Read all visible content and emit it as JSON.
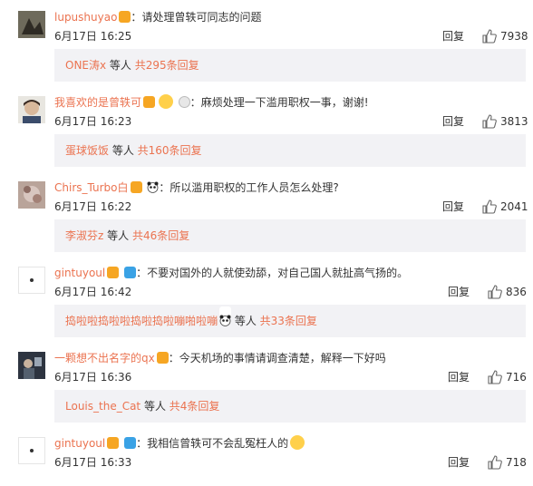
{
  "comments": [
    {
      "username": "lupushuyao",
      "text": "请处理曾轶可同志的问题",
      "time": "6月17日 16:25",
      "reply_label": "回复",
      "likes": "7938",
      "reply_summary": {
        "names": "ONE涛x",
        "middle": " 等人 ",
        "count": "共295条回复"
      }
    },
    {
      "username": "我喜欢的是曾轶可",
      "text": "麻烦处理一下滥用职权一事，谢谢!",
      "time": "6月17日 16:23",
      "reply_label": "回复",
      "likes": "3813",
      "reply_summary": {
        "names": "蛋球饭饭",
        "middle": " 等人 ",
        "count": "共160条回复"
      }
    },
    {
      "username": "Chirs_Turbo白",
      "text": "所以滥用职权的工作人员怎么处理?",
      "time": "6月17日 16:22",
      "reply_label": "回复",
      "likes": "2041",
      "reply_summary": {
        "names": "李淑芬z",
        "middle": " 等人 ",
        "count": "共46条回复"
      }
    },
    {
      "username": "gintuyoul",
      "text": "不要对国外的人就使劲舔，对自己国人就扯高气扬的。",
      "time": "6月17日 16:42",
      "reply_label": "回复",
      "likes": "836",
      "reply_summary": {
        "names": "捣啦啦捣啦啦捣啦捣啦嘣啪啦嘣",
        "middle": " 等人 ",
        "count": "共33条回复"
      }
    },
    {
      "username": "一颗想不出名字的qx",
      "text": "今天机场的事情请调查清楚，解释一下好吗",
      "time": "6月17日 16:36",
      "reply_label": "回复",
      "likes": "716",
      "reply_summary": {
        "names": "Louis_the_Cat",
        "middle": " 等人 ",
        "count": "共4条回复"
      }
    },
    {
      "username": "gintuyoul",
      "text": "我相信曾轶可不会乱冤枉人的",
      "time": "6月17日 16:33",
      "reply_label": "回复",
      "likes": "718"
    }
  ],
  "colors": {
    "accent": "#eb7350",
    "reply_bg": "#f2f2f5",
    "text": "#333333"
  }
}
